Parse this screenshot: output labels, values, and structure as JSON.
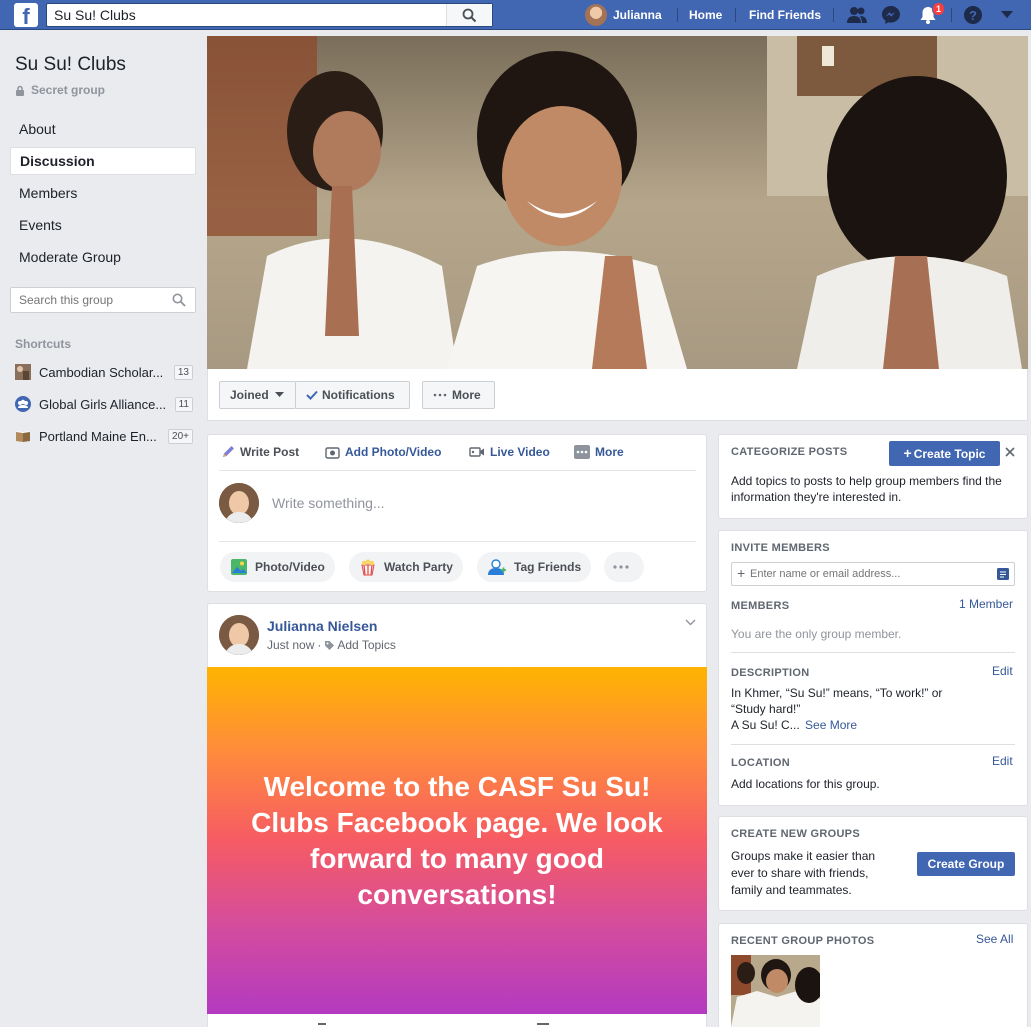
{
  "topbar": {
    "search_value": "Su Su! Clubs",
    "user_name": "Julianna",
    "home": "Home",
    "find_friends": "Find Friends",
    "notification_count": "1"
  },
  "group": {
    "name": "Su Su! Clubs",
    "privacy": "Secret group"
  },
  "nav": {
    "items": [
      {
        "label": "About"
      },
      {
        "label": "Discussion"
      },
      {
        "label": "Members"
      },
      {
        "label": "Events"
      },
      {
        "label": "Moderate Group"
      }
    ],
    "search_placeholder": "Search this group"
  },
  "shortcuts": {
    "heading": "Shortcuts",
    "items": [
      {
        "label": "Cambodian Scholar...",
        "count": "13"
      },
      {
        "label": "Global Girls Alliance...",
        "count": "11"
      },
      {
        "label": "Portland Maine En...",
        "count": "20+"
      }
    ]
  },
  "cover_actions": {
    "joined": "Joined",
    "notifications": "Notifications",
    "more": "More"
  },
  "composer": {
    "write_post": "Write Post",
    "add_photo": "Add Photo/Video",
    "live_video": "Live Video",
    "more": "More",
    "placeholder": "Write something...",
    "pill_photo": "Photo/Video",
    "pill_watch": "Watch Party",
    "pill_tag": "Tag Friends"
  },
  "post": {
    "author": "Julianna Nielsen",
    "time": "Just now",
    "separator": "·",
    "add_topics": "Add Topics",
    "text": "Welcome to the CASF Su Su! Clubs Facebook page. We look forward to many good conversations!"
  },
  "categorize": {
    "heading": "CATEGORIZE POSTS",
    "button": "Create Topic",
    "text": "Add topics to posts to help group members find the information they're interested in."
  },
  "invite": {
    "heading": "INVITE MEMBERS",
    "placeholder": "Enter name or email address..."
  },
  "members": {
    "heading": "MEMBERS",
    "count": "1 Member",
    "text": "You are the only group member."
  },
  "description": {
    "heading": "DESCRIPTION",
    "edit": "Edit",
    "line1": "In Khmer, “Su Su!” means, “To work!” or",
    "line2": "“Study hard!”",
    "line3": "A Su Su! C...",
    "see_more": "See More"
  },
  "location": {
    "heading": "LOCATION",
    "edit": "Edit",
    "text": "Add locations for this group."
  },
  "create_groups": {
    "heading": "CREATE NEW GROUPS",
    "text_line1": "Groups make it easier than",
    "text_line2": "ever to share with friends,",
    "text_line3": "family and teammates.",
    "button": "Create Group"
  },
  "photos": {
    "heading": "RECENT GROUP PHOTOS",
    "see_all": "See All"
  },
  "colors": {
    "brand_blue": "#4267b2",
    "link_blue": "#365899",
    "background": "#e9ebee"
  }
}
